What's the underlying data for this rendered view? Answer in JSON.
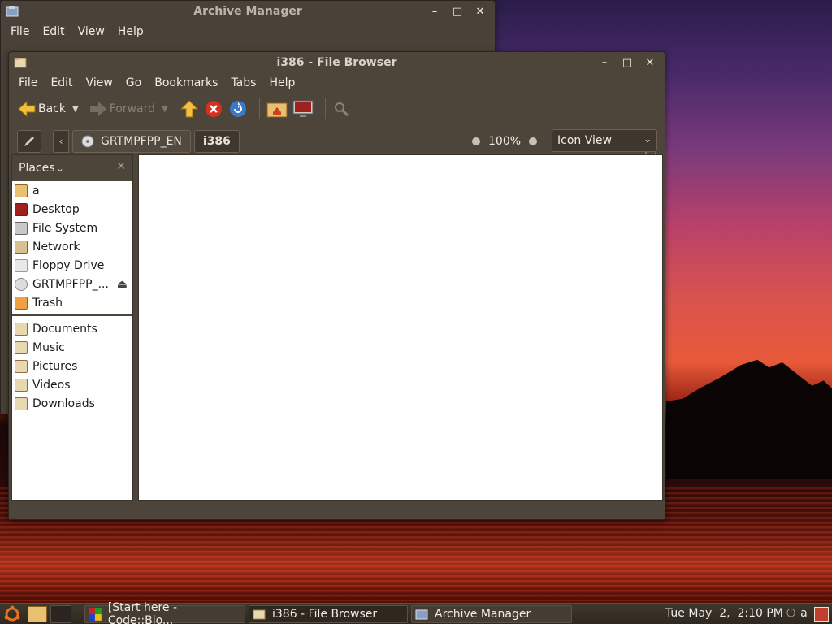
{
  "archive_window": {
    "title": "Archive Manager",
    "menu": [
      "File",
      "Edit",
      "View",
      "Help"
    ]
  },
  "browser_window": {
    "title": "i386 - File Browser",
    "menu": [
      "File",
      "Edit",
      "View",
      "Go",
      "Bookmarks",
      "Tabs",
      "Help"
    ],
    "toolbar": {
      "back_label": "Back",
      "forward_label": "Forward"
    },
    "location": {
      "crumbs": [
        "GRTMPFPP_EN",
        "i386"
      ],
      "zoom": "100%",
      "view_mode": "Icon View"
    },
    "sidebar": {
      "header": "Places",
      "places": [
        {
          "label": "a",
          "icon": "home-folder-icon"
        },
        {
          "label": "Desktop",
          "icon": "desktop-icon"
        },
        {
          "label": "File System",
          "icon": "filesystem-icon"
        },
        {
          "label": "Network",
          "icon": "network-icon"
        },
        {
          "label": "Floppy Drive",
          "icon": "floppy-icon"
        },
        {
          "label": "GRTMPFPP_...",
          "icon": "cdrom-icon"
        },
        {
          "label": "Trash",
          "icon": "trash-icon"
        }
      ],
      "bookmarks": [
        {
          "label": "Documents",
          "icon": "documents-folder-icon"
        },
        {
          "label": "Music",
          "icon": "music-folder-icon"
        },
        {
          "label": "Pictures",
          "icon": "pictures-folder-icon"
        },
        {
          "label": "Videos",
          "icon": "videos-folder-icon"
        },
        {
          "label": "Downloads",
          "icon": "downloads-folder-icon"
        }
      ]
    }
  },
  "taskbar": {
    "items": [
      {
        "label": "[Start here - Code::Blo..."
      },
      {
        "label": "i386 - File Browser"
      },
      {
        "label": "Archive Manager"
      }
    ],
    "clock": "Tue May  2,  2:10 PM",
    "user": "a"
  }
}
